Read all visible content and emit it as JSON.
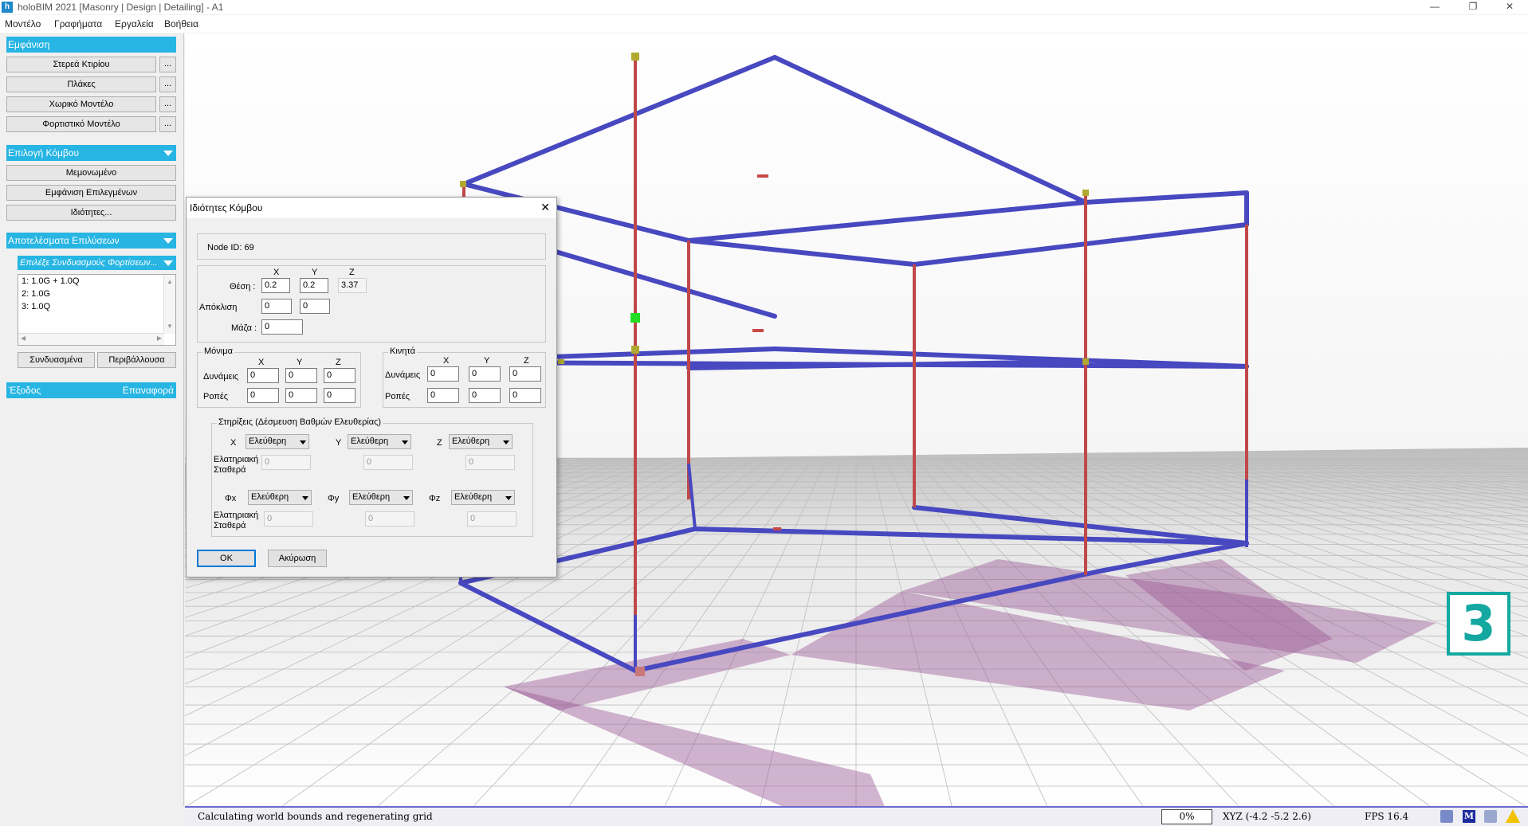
{
  "app": {
    "title": "holoBIM 2021 [Masonry | Design | Detailing] - A1",
    "menu": [
      "Μοντέλο",
      "Γραφήματα",
      "Εργαλεία",
      "Βοήθεια"
    ]
  },
  "sidebar": {
    "display_header": "Εμφάνιση",
    "display_buttons": [
      "Στερεά Κτιρίου",
      "Πλάκες",
      "Χωρικό Μοντέλο",
      "Φορτιστικό Μοντέλο"
    ],
    "dots_label": "...",
    "node_header": "Επιλογή Κόμβου",
    "node_buttons": [
      "Μεμονωμένο",
      "Εμφάνιση Επιλεγμένων",
      "Ιδιότητες..."
    ],
    "results_header": "Αποτελέσματα Επιλύσεων",
    "combo_placeholder": "Επιλέξε Συνδυασμούς Φορτίσεων...",
    "load_combos": [
      "1: 1.0G + 1.0Q",
      "2: 1.0G",
      "3: 1.0Q"
    ],
    "combined_button": "Συνδυασμένα",
    "envelope_button": "Περιβάλλουσα",
    "exit_label": "Έξοδος",
    "reset_label": "Επαναφορά"
  },
  "dialog": {
    "title": "Ιδιότητες Κόμβου",
    "node_id": "Node ID: 69",
    "axes": [
      "X",
      "Y",
      "Z"
    ],
    "position_label": "Θέση :",
    "position": [
      "0.2",
      "0.2",
      "3.37"
    ],
    "deviation_label": "Απόκλιση",
    "deviation": [
      "0",
      "0"
    ],
    "mass_label": "Μάζα :",
    "mass": "0",
    "permanent_group": "Μόνιμα",
    "live_group": "Κινητά",
    "forces_label": "Δυνάμεις",
    "moments_label": "Ροπές",
    "permanent_forces": [
      "0",
      "0",
      "0"
    ],
    "permanent_moments": [
      "0",
      "0",
      "0"
    ],
    "live_forces": [
      "0",
      "0",
      "0"
    ],
    "live_moments": [
      "0",
      "0",
      "0"
    ],
    "supports_group": "Στηρίξεις (Δέσμευση Βαθμών Ελευθερίας)",
    "free_option": "Ελεύθερη",
    "rot_axes": [
      "Φx",
      "Φy",
      "Φz"
    ],
    "stiffness_label_1": "Ελατηριακή",
    "stiffness_label_2": "Σταθερά",
    "stiffness_values": [
      "0",
      "0",
      "0",
      "0",
      "0",
      "0"
    ],
    "ok_button": "OK",
    "cancel_button": "Ακύρωση"
  },
  "status": {
    "message": "Calculating world bounds and regenerating grid",
    "progress": "0%",
    "coords": "XYZ (-4.2 -5.2 2.6)",
    "fps": "FPS  16.4",
    "view_number": "3",
    "m_icon_label": "M"
  },
  "colors": {
    "accent": "#27b5e3",
    "beam": "#4848c0",
    "column": "#c04848",
    "foundation": "#9c5b96",
    "selected_node": "#22dd22",
    "view_badge": "#14a8a0"
  }
}
